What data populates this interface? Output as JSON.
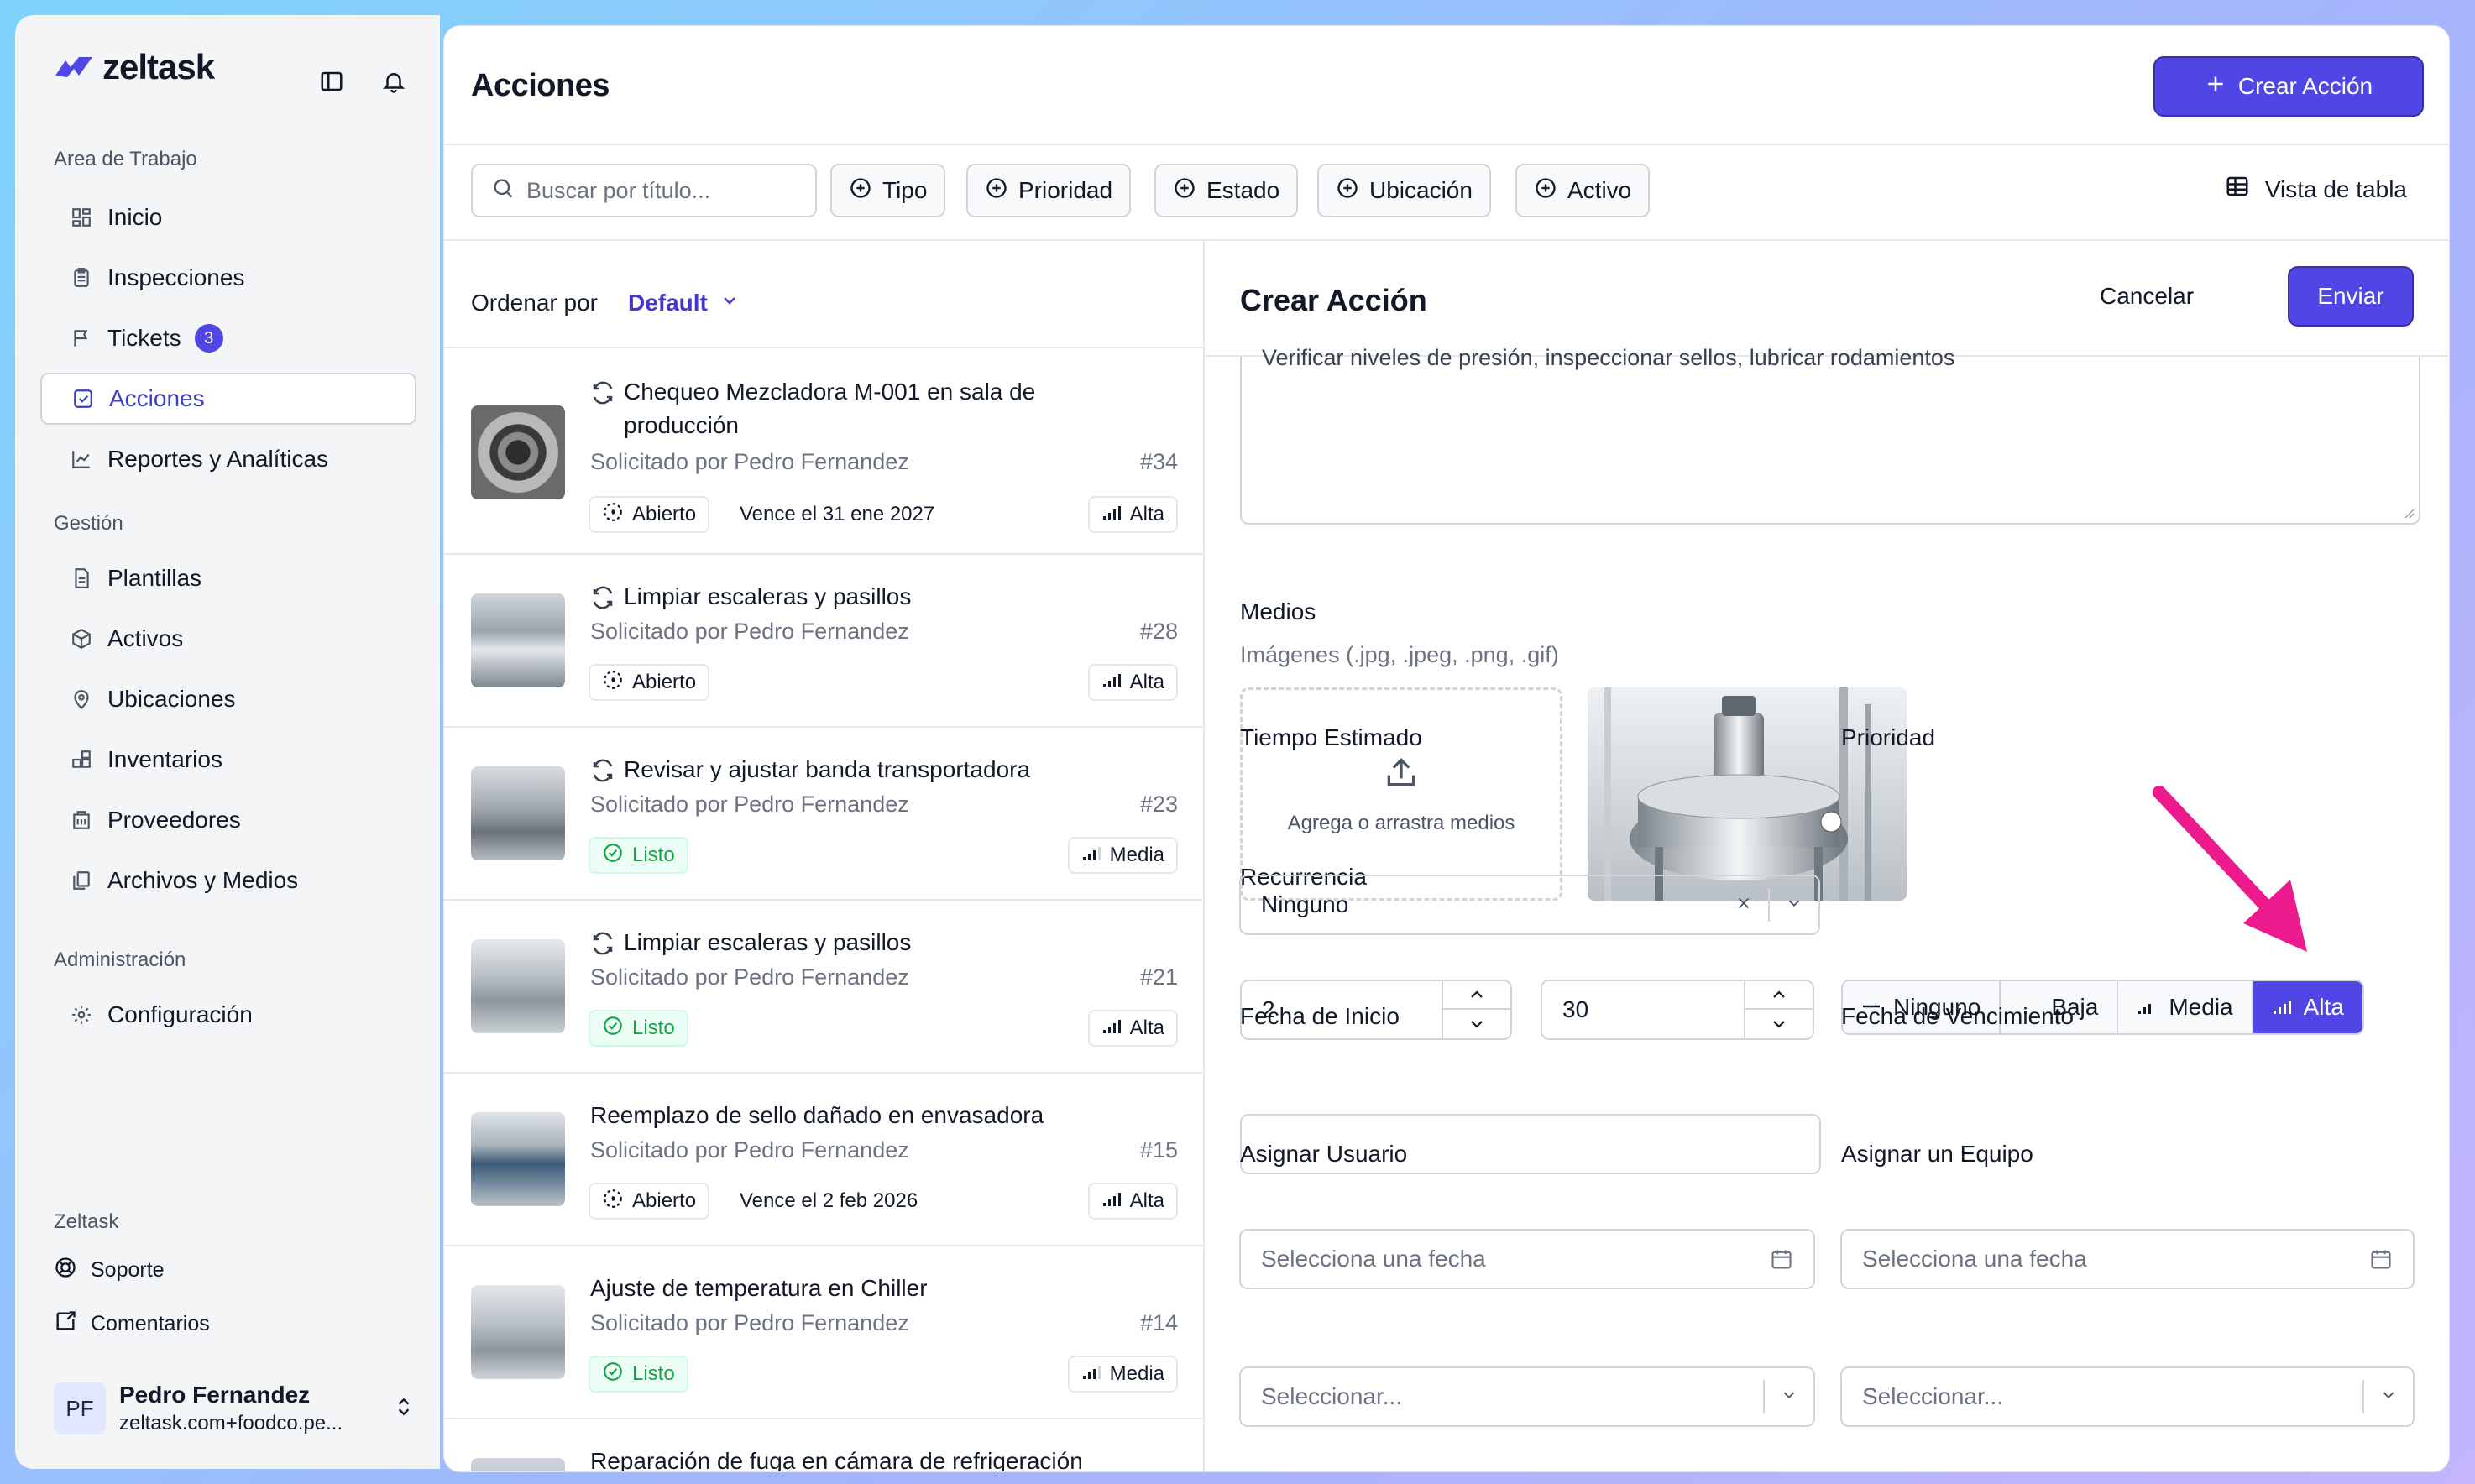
{
  "app": {
    "name": "zeltask"
  },
  "sidebar": {
    "workspace_label": "Area de Trabajo",
    "workspace_items": [
      {
        "label": "Inicio",
        "icon": "dashboard-icon"
      },
      {
        "label": "Inspecciones",
        "icon": "clipboard-icon"
      },
      {
        "label": "Tickets",
        "icon": "flag-icon",
        "badge": "3"
      },
      {
        "label": "Acciones",
        "icon": "checkbox-icon",
        "active": true
      },
      {
        "label": "Reportes y Analíticas",
        "icon": "chart-icon"
      }
    ],
    "management_label": "Gestión",
    "management_items": [
      {
        "label": "Plantillas",
        "icon": "file-icon"
      },
      {
        "label": "Activos",
        "icon": "cube-icon"
      },
      {
        "label": "Ubicaciones",
        "icon": "map-pin-icon"
      },
      {
        "label": "Inventarios",
        "icon": "boxes-icon"
      },
      {
        "label": "Proveedores",
        "icon": "building-icon"
      },
      {
        "label": "Archivos y Medios",
        "icon": "files-icon"
      }
    ],
    "admin_label": "Administración",
    "admin_items": [
      {
        "label": "Configuración",
        "icon": "gear-icon"
      }
    ],
    "footer_label": "Zeltask",
    "footer_items": [
      {
        "label": "Soporte",
        "icon": "lifebuoy-icon"
      },
      {
        "label": "Comentarios",
        "icon": "message-icon"
      }
    ],
    "user": {
      "initials": "PF",
      "name": "Pedro Fernandez",
      "email": "zeltask.com+foodco.pe..."
    }
  },
  "header": {
    "title": "Acciones",
    "create_button": "Crear Acción",
    "search_placeholder": "Buscar por título...",
    "filters": [
      "Tipo",
      "Prioridad",
      "Estado",
      "Ubicación",
      "Activo"
    ],
    "table_view": "Vista de tabla"
  },
  "list": {
    "sort_label": "Ordenar por",
    "sort_value": "Default",
    "items": [
      {
        "title_line1": "Chequeo Mezcladora M-001 en sala de",
        "title_line2": "producción",
        "recurring": true,
        "requested": "Solicitado por Pedro Fernandez",
        "number": "#34",
        "status": "Abierto",
        "due": "Vence el 31 ene 2027",
        "priority": "Alta"
      },
      {
        "title_line1": "Limpiar escaleras y pasillos",
        "recurring": true,
        "requested": "Solicitado por Pedro Fernandez",
        "number": "#28",
        "status": "Abierto",
        "priority": "Alta"
      },
      {
        "title_line1": "Revisar y ajustar banda transportadora",
        "recurring": true,
        "requested": "Solicitado por Pedro Fernandez",
        "number": "#23",
        "status": "Listo",
        "priority": "Media"
      },
      {
        "title_line1": "Limpiar escaleras y pasillos",
        "recurring": true,
        "requested": "Solicitado por Pedro Fernandez",
        "number": "#21",
        "status": "Listo",
        "priority": "Alta"
      },
      {
        "title_line1": "Reemplazo de sello dañado en envasadora",
        "recurring": false,
        "requested": "Solicitado por Pedro Fernandez",
        "number": "#15",
        "status": "Abierto",
        "due": "Vence el 2 feb 2026",
        "priority": "Alta"
      },
      {
        "title_line1": "Ajuste de temperatura en Chiller",
        "recurring": false,
        "requested": "Solicitado por Pedro Fernandez",
        "number": "#14",
        "status": "Listo",
        "priority": "Media"
      },
      {
        "title_line1": "Reparación de fuga en cámara de refrigeración",
        "recurring": false
      }
    ]
  },
  "form": {
    "title": "Crear Acción",
    "cancel": "Cancelar",
    "submit": "Enviar",
    "description_text": "Verificar niveles de presión, inspeccionar sellos, lubricar rodamientos",
    "media_label": "Medios",
    "media_help": "Imágenes (.jpg, .jpeg, .png, .gif)",
    "dropzone_text": "Agrega o arrastra medios",
    "time_label": "Tiempo Estimado",
    "hours_value": "2",
    "minutes_value": "30",
    "priority_label": "Prioridad",
    "priority_options": [
      "Ninguno",
      "Baja",
      "Media",
      "Alta"
    ],
    "priority_selected": "Alta",
    "recurrence_label": "Recurrencia",
    "recurrence_value": "Ninguno",
    "start_label": "Fecha de Inicio",
    "start_placeholder": "Selecciona una fecha",
    "due_label": "Fecha de Vencimiento",
    "due_placeholder": "Selecciona una fecha",
    "assign_user_label": "Asignar Usuario",
    "assign_user_placeholder": "Seleccionar...",
    "assign_team_label": "Asignar un Equipo",
    "assign_team_placeholder": "Seleccionar..."
  },
  "colors": {
    "accent": "#4f46e5",
    "annotation_arrow": "#ec1a8c",
    "success": "#16a34a"
  }
}
